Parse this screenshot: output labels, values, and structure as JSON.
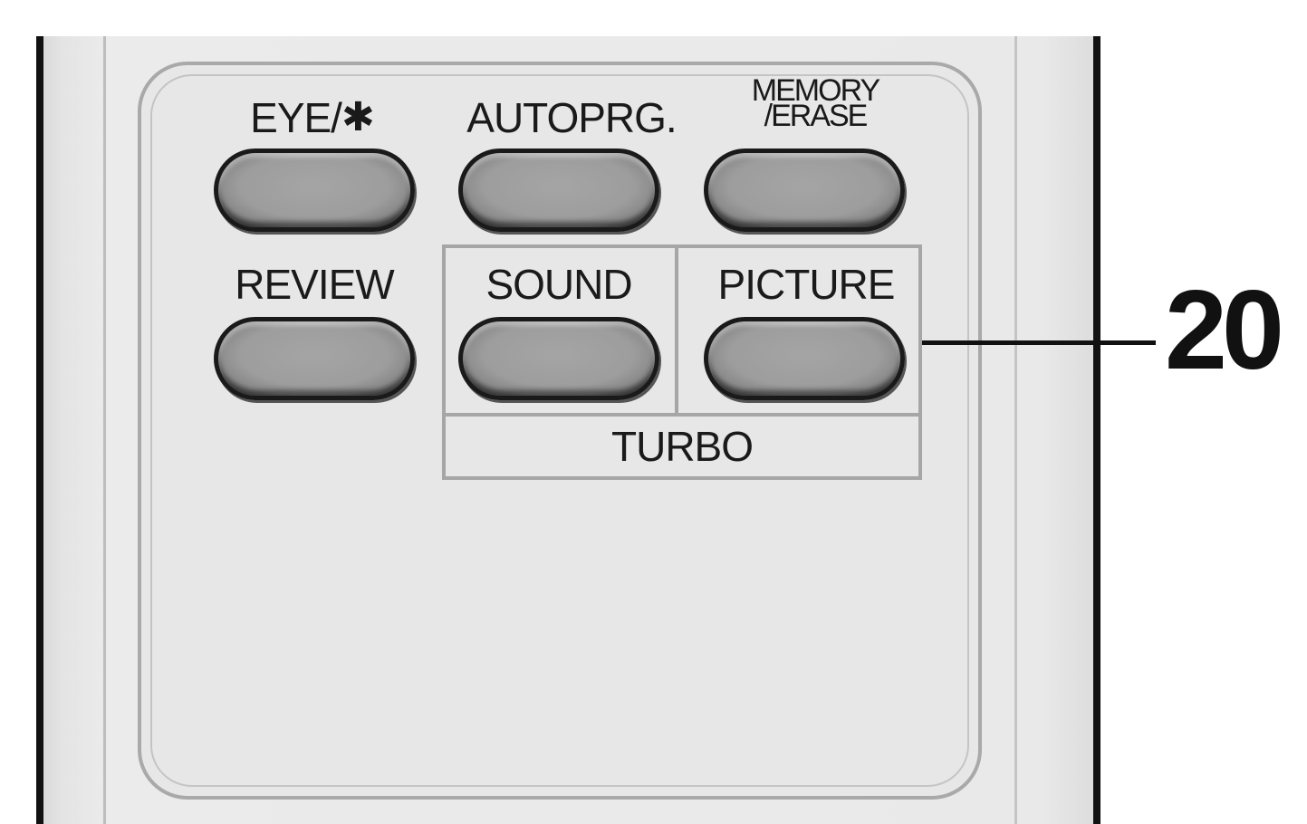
{
  "buttons": {
    "eye": {
      "label": "EYE/",
      "symbol": "✱"
    },
    "autoprg": {
      "label": "AUTOPRG."
    },
    "memory_erase": {
      "label_line1": "MEMORY",
      "label_line2": "/ERASE"
    },
    "review": {
      "label": "REVIEW"
    },
    "sound": {
      "label": "SOUND"
    },
    "picture": {
      "label": "PICTURE"
    }
  },
  "turbo_group": {
    "label": "TURBO"
  },
  "callout": {
    "number": "20"
  }
}
